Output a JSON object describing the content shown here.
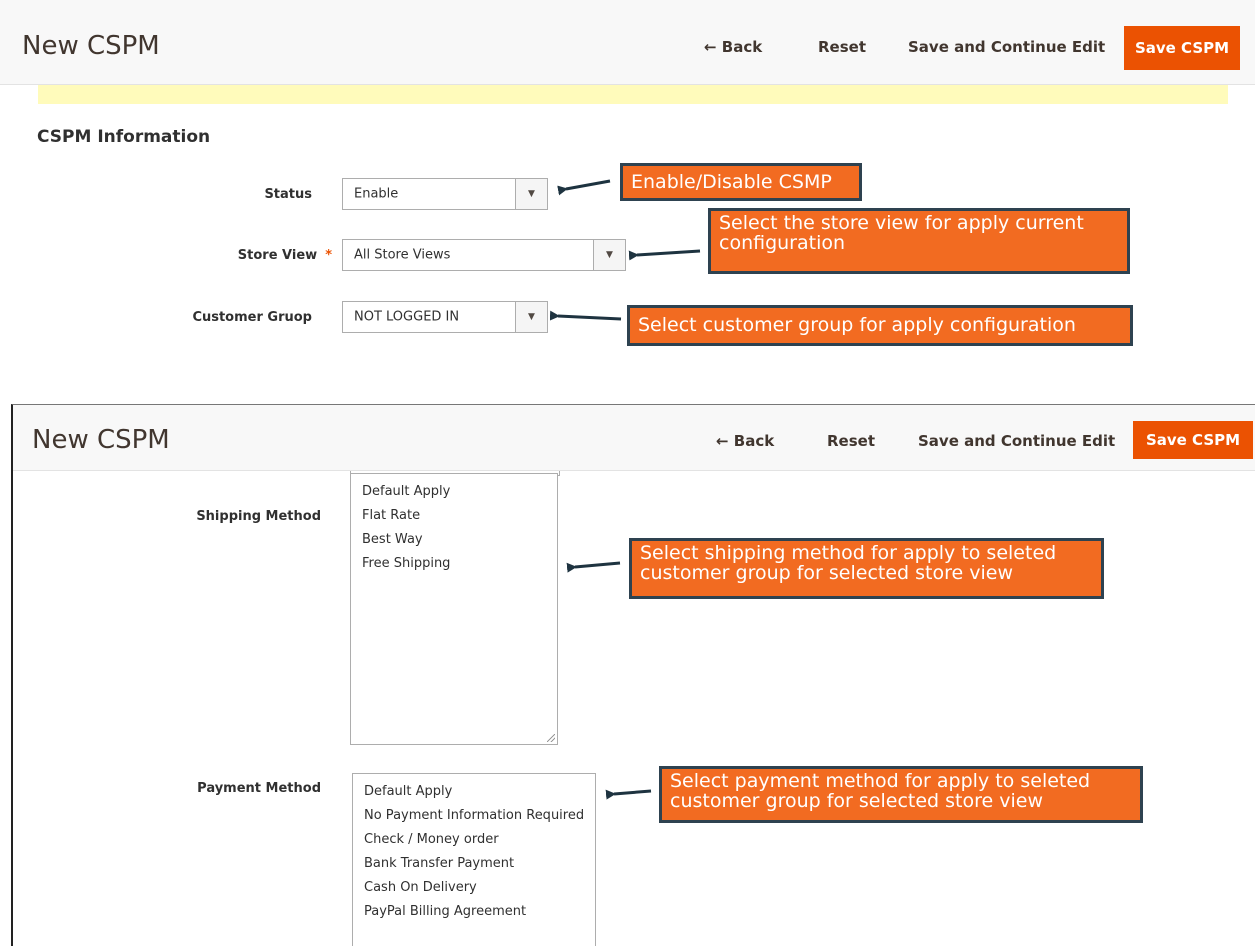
{
  "panel_top": {
    "header": {
      "title": "New CSPM",
      "back_label": "← Back",
      "reset_label": "Reset",
      "save_continue_label": "Save and Continue Edit",
      "save_label": "Save CSPM"
    },
    "section_title": "CSPM Information",
    "fields": {
      "status": {
        "label": "Status",
        "value": "Enable"
      },
      "store_view": {
        "label": "Store View",
        "required_mark": "*",
        "value": "All Store Views"
      },
      "customer_group": {
        "label": "Customer Gruop",
        "value": "NOT LOGGED IN"
      }
    },
    "callouts": {
      "status": "Enable/Disable CSMP",
      "store_view": "Select the store view for apply current configuration",
      "customer_group": "Select customer group for apply configuration"
    }
  },
  "panel_bottom": {
    "header": {
      "title": "New CSPM",
      "back_label": "← Back",
      "reset_label": "Reset",
      "save_continue_label": "Save and Continue Edit",
      "save_label": "Save CSPM"
    },
    "shipping": {
      "label": "Shipping Method",
      "options": [
        "Default Apply",
        "Flat Rate",
        "Best Way",
        "Free Shipping"
      ],
      "callout": "Select shipping method for apply to seleted customer group for selected store view"
    },
    "payment": {
      "label": "Payment Method",
      "options": [
        "Default Apply",
        "No Payment Information Required",
        "Check / Money order",
        "Bank Transfer Payment",
        "Cash On Delivery",
        "PayPal Billing Agreement"
      ],
      "callout": "Select payment method for apply to seleted customer group for selected store view"
    }
  },
  "colors": {
    "accent": "#eb5202",
    "callout_fill": "#f26b21",
    "callout_border": "#2e4250",
    "notice_bg": "#fffbbb"
  },
  "icons": [
    "back-arrow-icon",
    "dropdown-caret-icon",
    "callout-arrow-icon",
    "resize-grip-icon"
  ]
}
